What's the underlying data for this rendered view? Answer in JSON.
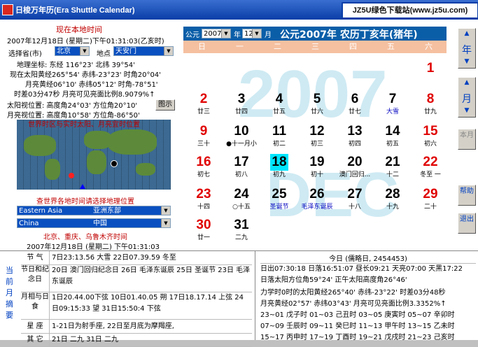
{
  "window": {
    "title": "日梭万年历(Era Shuttle Calendar)",
    "watermark": "JZ5U绿色下载站(www.jz5u.com)"
  },
  "left": {
    "heading": "现在本地时间",
    "datetime": "2007年12月18日 (星期二)下午01:31:03(乙亥时)",
    "province_label": "选择省(市)",
    "province_value": "北京",
    "place_label": "地点",
    "place_value": "天安门",
    "geo": "地理坐标: 东经 116°23' 北纬 39°54'",
    "sun": "现在太阳黄经265°54' 赤纬-23°23' 时角20°04'",
    "moon": "月亮黄经06°10' 赤纬05°12' 时角-78°51'",
    "phase": "时差03分47秒 月亮可见亮面比例8.9079%↑",
    "sun_pos": "太阳视位置: 高度角24°03' 方位角20°10'",
    "moon_pos": "月亮视位置: 高度角10°58' 方位角-86°50'",
    "map_button": "图示",
    "map_title": "世界时区与实时太阳、月亮宜时位置",
    "select_title": "查世界各地时间请选择地理位置",
    "region1_label": "Eastern Asia",
    "region1_value": "亚洲东部",
    "region2_label": "China",
    "region2_value": "中国",
    "city_line": "北京、重庆、乌鲁木齐时间",
    "city_time": "2007年12月18日 (星期二) 下午01:31:03"
  },
  "calendar": {
    "year_prefix": "公元",
    "year": "2007",
    "year_suffix": "年",
    "month": "12",
    "month_suffix": "月",
    "header_title": "公元2007年 农历丁亥年(猪年)",
    "weekdays": [
      "日",
      "一",
      "二",
      "三",
      "四",
      "五",
      "六"
    ],
    "days": [
      {
        "d": "1",
        "l": ""
      },
      {
        "d": "2",
        "l": "廿三"
      },
      {
        "d": "3",
        "l": "廿四"
      },
      {
        "d": "4",
        "l": "廿五"
      },
      {
        "d": "5",
        "l": "廿六"
      },
      {
        "d": "6",
        "l": "廿七"
      },
      {
        "d": "7",
        "l": "大雪"
      },
      {
        "d": "8",
        "l": "廿九"
      },
      {
        "d": "9",
        "l": "三十"
      },
      {
        "d": "10",
        "l": "●十一月小"
      },
      {
        "d": "11",
        "l": "初二"
      },
      {
        "d": "12",
        "l": "初三"
      },
      {
        "d": "13",
        "l": "初四"
      },
      {
        "d": "14",
        "l": "初五"
      },
      {
        "d": "15",
        "l": "初六"
      },
      {
        "d": "16",
        "l": "初七"
      },
      {
        "d": "17",
        "l": "初八"
      },
      {
        "d": "18",
        "l": "初九"
      },
      {
        "d": "19",
        "l": "初十"
      },
      {
        "d": "20",
        "l": "澳门回归..."
      },
      {
        "d": "21",
        "l": "十二"
      },
      {
        "d": "22",
        "l": "冬至 一"
      },
      {
        "d": "23",
        "l": "十四"
      },
      {
        "d": "24",
        "l": "○十五"
      },
      {
        "d": "25",
        "l": "圣诞节"
      },
      {
        "d": "26",
        "l": "毛泽东诞辰"
      },
      {
        "d": "27",
        "l": "十八"
      },
      {
        "d": "28",
        "l": "十九"
      },
      {
        "d": "29",
        "l": "二十"
      },
      {
        "d": "30",
        "l": "廿一"
      },
      {
        "d": "31",
        "l": "二九"
      }
    ],
    "year_button": "年",
    "month_button": "月",
    "this_month_button": "本月",
    "help_button": "帮助",
    "exit_button": "退出",
    "watermark_year": "2007",
    "watermark_month": "DEC"
  },
  "bottom": {
    "side_label": "当前月摘要",
    "rows": [
      {
        "k": "节 气",
        "v": "7日23:13.56 大雪    22日07.39.59 冬至"
      },
      {
        "k": "节日和纪念日",
        "v": "20日 澳门回归纪念日 26日 毛泽东诞辰 25日 圣诞节 23日 毛泽东诞辰"
      },
      {
        "k": "月相与日食",
        "v": "1日20.44.00下弦  10日01.40.05 朔  17日18.17.14 上弦  24日09:15:33 望  31日15:50:4  下弦"
      },
      {
        "k": "星 座",
        "v": "1-21日为射手座, 22日至月底为摩羯座,"
      },
      {
        "k": "其 它",
        "v": "21日 二九  31日 二九"
      }
    ],
    "today_title": "今日 (儒略日, 2454453)",
    "today_lines": [
      "日出07:30:18 日落16:51:07 昼长09:21 天亮07:00 天黑17:22",
      "日落太阳方位角59°24' 正午太阳高度角26°46'",
      "力学时0时的太阳黄经265°40' 赤纬-23°22' 时差03分48秒",
      "月亮黄经02°57' 赤纬03°43' 月亮可见亮面比例3.3352%↑",
      "23~01 戊子时  01~03 己丑时  03~05 庚寅时  05~07 辛卯时",
      "07~09 壬辰时  09~11 癸巳时  11~13 甲午时  13~15 乙未时",
      "15~17 丙申时  17~19 丁酉时  19~21 戊戌时  21~23 己亥时"
    ]
  }
}
